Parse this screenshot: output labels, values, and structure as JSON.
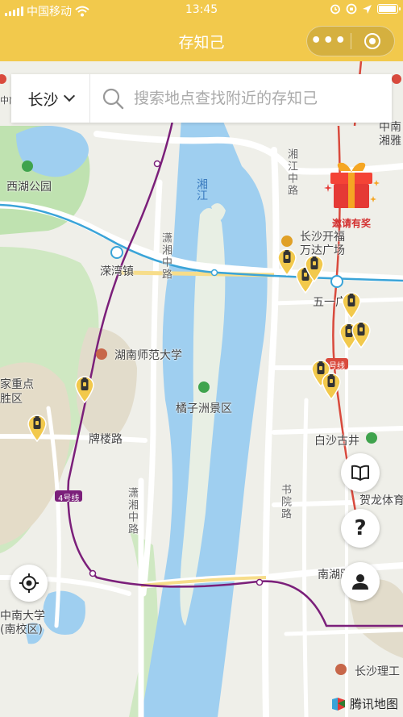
{
  "status_bar": {
    "carrier": "中国移动",
    "time": "13:45"
  },
  "nav": {
    "title": "存知己",
    "more_label": "•••"
  },
  "search": {
    "city": "长沙",
    "placeholder": "搜索地点查找附近的存知己"
  },
  "map_labels": {
    "west_lake_park": "西湖公园",
    "luanwan_town": "溁湾镇",
    "xiangjiang_river": "湘江",
    "xiaoxiang_road_north": "潇湘中路",
    "xiaoxiang_road_south": "潇湘中路",
    "hunan_normal_univ": "湖南师范大学",
    "juzizhou": "橘子洲景区",
    "pailou_road": "牌楼路",
    "central_south_univ": "中南大学\n(南校区)",
    "state_key_area": "家重点\n胜区",
    "xiangjiang_road_middle": "湘江中路",
    "wanda_plaza": "长沙开福\n万达广场",
    "wuyi": "五一广",
    "baisha_well": "白沙古井",
    "shuyuan_road": "书院路",
    "nanhu_road": "南湖路",
    "helong_stadium": "贺龙体育",
    "changsha_polytechnic": "长沙理工",
    "zhongnan_xiangya": "中南\n湘雅",
    "zhongnan_top": "中南",
    "metro_line4": "4号线",
    "metro_line1": "号线"
  },
  "promo": {
    "label": "邀请有奖"
  },
  "buttons": {
    "help_label": "?"
  },
  "attribution": {
    "label": "腾讯地图"
  },
  "colors": {
    "brand": "#f2c94c",
    "water": "#9fcff0",
    "green": "#bfe2b0",
    "road": "#ffffff",
    "metro": "#7b1f7a"
  },
  "icons": {
    "book": "book-icon",
    "locate": "locate-icon",
    "user": "user-icon",
    "gift": "gift-icon",
    "pin": "locker-pin-icon"
  }
}
